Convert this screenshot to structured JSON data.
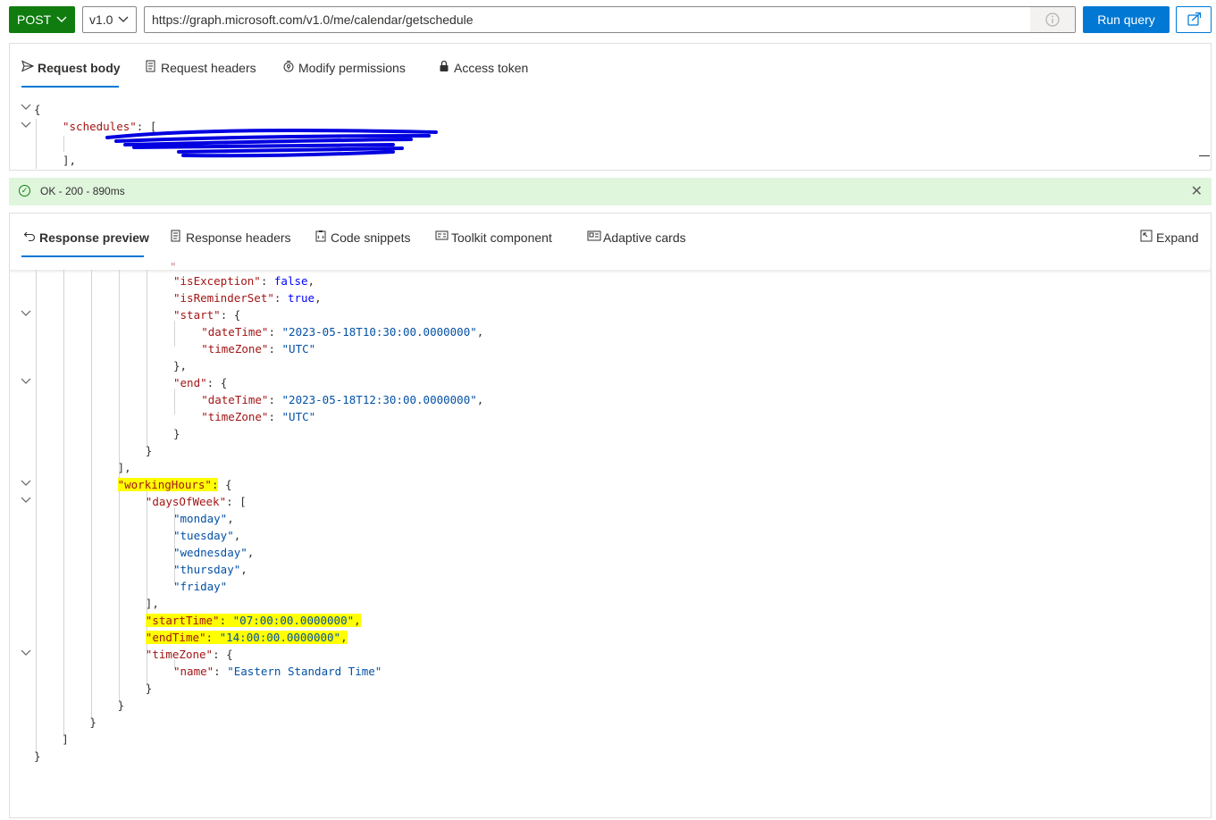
{
  "toolbar": {
    "method": "POST",
    "version": "v1.0",
    "url": "https://graph.microsoft.com/v1.0/me/calendar/getschedule",
    "run_label": "Run query",
    "icons": {
      "method_dropdown": "chevron-down-icon",
      "version_dropdown": "chevron-down-icon",
      "info": "info-icon",
      "share": "share-icon"
    }
  },
  "request_tabs": [
    {
      "label": "Request body",
      "icon": "send-icon",
      "active": true
    },
    {
      "label": "Request headers",
      "icon": "document-icon",
      "active": false
    },
    {
      "label": "Modify permissions",
      "icon": "shield-key-icon",
      "active": false
    },
    {
      "label": "Access token",
      "icon": "lock-icon",
      "active": false
    }
  ],
  "request_body": {
    "line1": "{",
    "line2_key": "\"schedules\"",
    "line2_rest": ": [",
    "line3": "],"
  },
  "status": {
    "text": "OK - 200 - 890ms",
    "color": "#107c10"
  },
  "response_tabs": [
    {
      "label": "Response preview",
      "icon": "undo-icon",
      "active": true
    },
    {
      "label": "Response headers",
      "icon": "document-icon",
      "active": false
    },
    {
      "label": "Code snippets",
      "icon": "clipboard-code-icon",
      "active": false
    },
    {
      "label": "Toolkit component",
      "icon": "toolkit-icon",
      "active": false
    },
    {
      "label": "Adaptive cards",
      "icon": "card-icon",
      "active": false
    }
  ],
  "expand_label": "Expand",
  "response_lines": [
    {
      "indent": 5,
      "parts": [
        [
          "k",
          "\"isException\""
        ],
        [
          "p",
          ": "
        ],
        [
          "b",
          "false"
        ],
        [
          "p",
          ","
        ]
      ]
    },
    {
      "indent": 5,
      "parts": [
        [
          "k",
          "\"isReminderSet\""
        ],
        [
          "p",
          ": "
        ],
        [
          "b",
          "true"
        ],
        [
          "p",
          ","
        ]
      ]
    },
    {
      "indent": 5,
      "fold": true,
      "parts": [
        [
          "k",
          "\"start\""
        ],
        [
          "p",
          ": {"
        ]
      ]
    },
    {
      "indent": 6,
      "parts": [
        [
          "k",
          "\"dateTime\""
        ],
        [
          "p",
          ": "
        ],
        [
          "s",
          "\"2023-05-18T10:30:00.0000000\""
        ],
        [
          "p",
          ","
        ]
      ]
    },
    {
      "indent": 6,
      "parts": [
        [
          "k",
          "\"timeZone\""
        ],
        [
          "p",
          ": "
        ],
        [
          "s",
          "\"UTC\""
        ]
      ]
    },
    {
      "indent": 5,
      "parts": [
        [
          "p",
          "},"
        ]
      ]
    },
    {
      "indent": 5,
      "fold": true,
      "parts": [
        [
          "k",
          "\"end\""
        ],
        [
          "p",
          ": {"
        ]
      ]
    },
    {
      "indent": 6,
      "parts": [
        [
          "k",
          "\"dateTime\""
        ],
        [
          "p",
          ": "
        ],
        [
          "s",
          "\"2023-05-18T12:30:00.0000000\""
        ],
        [
          "p",
          ","
        ]
      ]
    },
    {
      "indent": 6,
      "parts": [
        [
          "k",
          "\"timeZone\""
        ],
        [
          "p",
          ": "
        ],
        [
          "s",
          "\"UTC\""
        ]
      ]
    },
    {
      "indent": 5,
      "parts": [
        [
          "p",
          "}"
        ]
      ]
    },
    {
      "indent": 4,
      "parts": [
        [
          "p",
          "}"
        ]
      ]
    },
    {
      "indent": 3,
      "parts": [
        [
          "p",
          "],"
        ]
      ]
    },
    {
      "indent": 3,
      "fold": true,
      "hl": [
        0,
        1
      ],
      "parts": [
        [
          "k",
          "\"workingHours\""
        ],
        [
          "p",
          ":"
        ],
        [
          "p",
          " {"
        ]
      ]
    },
    {
      "indent": 4,
      "fold": true,
      "parts": [
        [
          "k",
          "\"daysOfWeek\""
        ],
        [
          "p",
          ": ["
        ]
      ]
    },
    {
      "indent": 5,
      "parts": [
        [
          "s",
          "\"monday\""
        ],
        [
          "p",
          ","
        ]
      ]
    },
    {
      "indent": 5,
      "parts": [
        [
          "s",
          "\"tuesday\""
        ],
        [
          "p",
          ","
        ]
      ]
    },
    {
      "indent": 5,
      "parts": [
        [
          "s",
          "\"wednesday\""
        ],
        [
          "p",
          ","
        ]
      ]
    },
    {
      "indent": 5,
      "parts": [
        [
          "s",
          "\"thursday\""
        ],
        [
          "p",
          ","
        ]
      ]
    },
    {
      "indent": 5,
      "parts": [
        [
          "s",
          "\"friday\""
        ]
      ]
    },
    {
      "indent": 4,
      "parts": [
        [
          "p",
          "],"
        ]
      ]
    },
    {
      "indent": 4,
      "hl": [
        0,
        1,
        2,
        3
      ],
      "parts": [
        [
          "k",
          "\"startTime\""
        ],
        [
          "p",
          ": "
        ],
        [
          "s",
          "\"07:00:00.0000000\""
        ],
        [
          "p",
          ","
        ]
      ]
    },
    {
      "indent": 4,
      "hl": [
        0,
        1,
        2,
        3
      ],
      "parts": [
        [
          "k",
          "\"endTime\""
        ],
        [
          "p",
          ": "
        ],
        [
          "s",
          "\"14:00:00.0000000\""
        ],
        [
          "p",
          ","
        ]
      ]
    },
    {
      "indent": 4,
      "fold": true,
      "parts": [
        [
          "k",
          "\"timeZone\""
        ],
        [
          "p",
          ": {"
        ]
      ]
    },
    {
      "indent": 5,
      "parts": [
        [
          "k",
          "\"name\""
        ],
        [
          "p",
          ": "
        ],
        [
          "s",
          "\"Eastern Standard Time\""
        ]
      ]
    },
    {
      "indent": 4,
      "parts": [
        [
          "p",
          "}"
        ]
      ]
    },
    {
      "indent": 3,
      "parts": [
        [
          "p",
          "}"
        ]
      ]
    },
    {
      "indent": 2,
      "parts": [
        [
          "p",
          "}"
        ]
      ]
    },
    {
      "indent": 1,
      "parts": [
        [
          "p",
          "]"
        ]
      ]
    },
    {
      "indent": 0,
      "parts": [
        [
          "p",
          "}"
        ]
      ]
    }
  ]
}
